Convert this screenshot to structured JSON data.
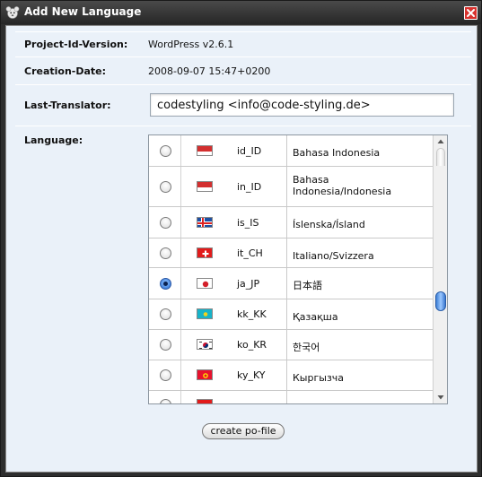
{
  "window": {
    "title": "Add New Language",
    "colors": {
      "titlebar": "#2e2e2e",
      "content_bg": "#eaf1f9",
      "close_button": "#d8322e",
      "radio_selected": "#2a6fd1"
    }
  },
  "fields": {
    "project_id_label": "Project-Id-Version:",
    "project_id_value": "WordPress v2.6.1",
    "creation_date_label": "Creation-Date:",
    "creation_date_value": "2008-09-07 15:47+0200",
    "last_translator_label": "Last-Translator:",
    "last_translator_value": "codestyling <info@code-styling.de>",
    "language_label": "Language:"
  },
  "languages": [
    {
      "code": "id_ID",
      "name": "Bahasa Indonesia",
      "selected": false,
      "flag": "indonesia-flag"
    },
    {
      "code": "in_ID",
      "name": "Bahasa Indonesia/Indonesia",
      "selected": false,
      "flag": "indonesia-flag"
    },
    {
      "code": "is_IS",
      "name": "Íslenska/Ísland",
      "selected": false,
      "flag": "iceland-flag"
    },
    {
      "code": "it_CH",
      "name": "Italiano/Svizzera",
      "selected": false,
      "flag": "switzerland-flag"
    },
    {
      "code": "ja_JP",
      "name": "日本語",
      "selected": true,
      "flag": "japan-flag"
    },
    {
      "code": "kk_KK",
      "name": "Қазақша",
      "selected": false,
      "flag": "kazakhstan-flag"
    },
    {
      "code": "ko_KR",
      "name": "한국어",
      "selected": false,
      "flag": "south-korea-flag"
    },
    {
      "code": "ky_KY",
      "name": "Кыргызча",
      "selected": false,
      "flag": "kyrgyzstan-flag"
    }
  ],
  "actions": {
    "create_label": "create po-file"
  }
}
